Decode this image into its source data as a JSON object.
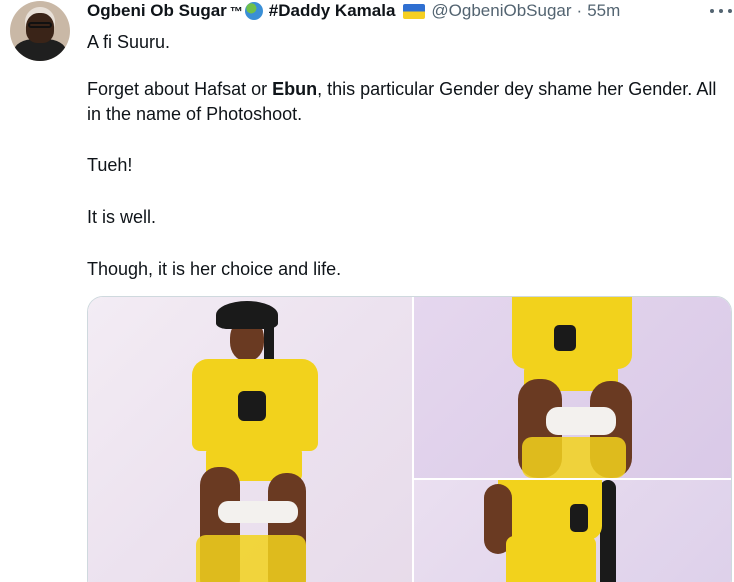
{
  "tweet": {
    "display_name": "Ogbeni Ob Sugar",
    "tm": "™",
    "hashtag": "#Daddy Kamala",
    "handle": "@OgbeniObSugar",
    "separator": "·",
    "time": "55m",
    "paragraphs": {
      "p1": "A fi Suuru.",
      "p2_before": "Forget about Hafsat or ",
      "p2_bold": "Ebun",
      "p2_after": ", this particular Gender dey shame her Gender. All in the name of Photoshoot.",
      "p3": "Tueh!",
      "p4": "It is well.",
      "p5": "Though, it is her choice and life."
    }
  },
  "icons": {
    "globe": "globe-emoji-icon",
    "flag": "ukraine-flag-icon",
    "more": "more-options-icon"
  },
  "colors": {
    "text": "#0f1419",
    "secondary": "#536471",
    "outfit_yellow": "#f2d21c"
  }
}
